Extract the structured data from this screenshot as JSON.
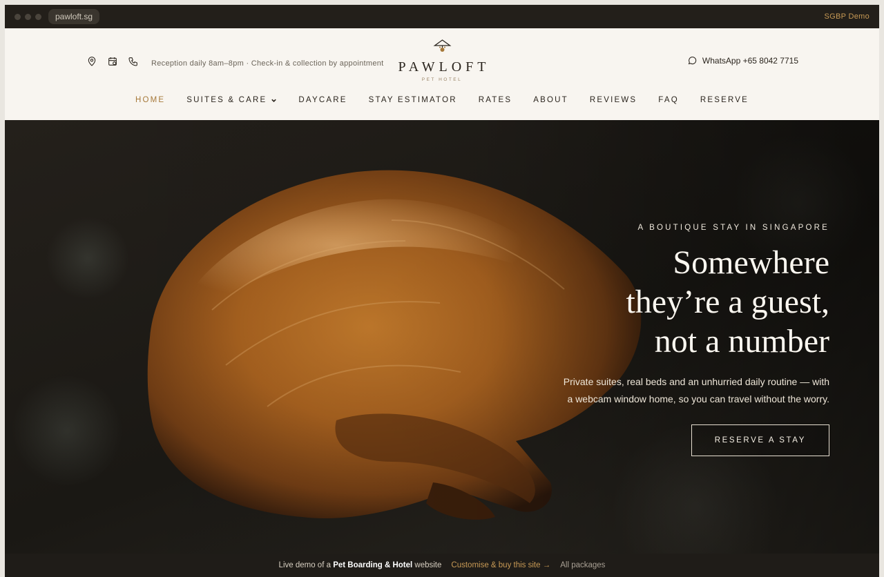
{
  "browser": {
    "url": "pawloft.sg",
    "demo_tag": "SGBP Demo"
  },
  "header": {
    "reception": "Reception daily 8am–8pm · Check-in & collection by appointment",
    "logo_name": "PAWLOFT",
    "logo_sub": "PET HOTEL",
    "whatsapp": "WhatsApp +65 8042 7715",
    "icons": [
      "map-pin-icon",
      "calendar-icon",
      "phone-icon",
      "whatsapp-icon"
    ]
  },
  "nav": {
    "items": [
      {
        "label": "HOME",
        "active": true
      },
      {
        "label": "SUITES & CARE",
        "dropdown": true
      },
      {
        "label": "DAYCARE"
      },
      {
        "label": "STAY ESTIMATOR"
      },
      {
        "label": "RATES"
      },
      {
        "label": "ABOUT"
      },
      {
        "label": "REVIEWS"
      },
      {
        "label": "FAQ"
      },
      {
        "label": "RESERVE"
      }
    ]
  },
  "hero": {
    "eyebrow": "A BOUTIQUE STAY IN SINGAPORE",
    "headline": [
      "Somewhere",
      "they’re a guest,",
      "not a number"
    ],
    "lede": [
      "Private suites, real beds and an unhurried daily routine — with",
      "a webcam window home, so you can travel without the worry."
    ],
    "cta": "RESERVE A STAY"
  },
  "demobar": {
    "prefix": "Live demo of a",
    "bold": "Pet Boarding & Hotel",
    "suffix": "website",
    "buy": "Customise & buy this site →",
    "packages": "All packages"
  },
  "colors": {
    "accent": "#a6793a",
    "dark": "#231f1a",
    "cream": "#f8f5f0",
    "gold": "#c89a55"
  }
}
